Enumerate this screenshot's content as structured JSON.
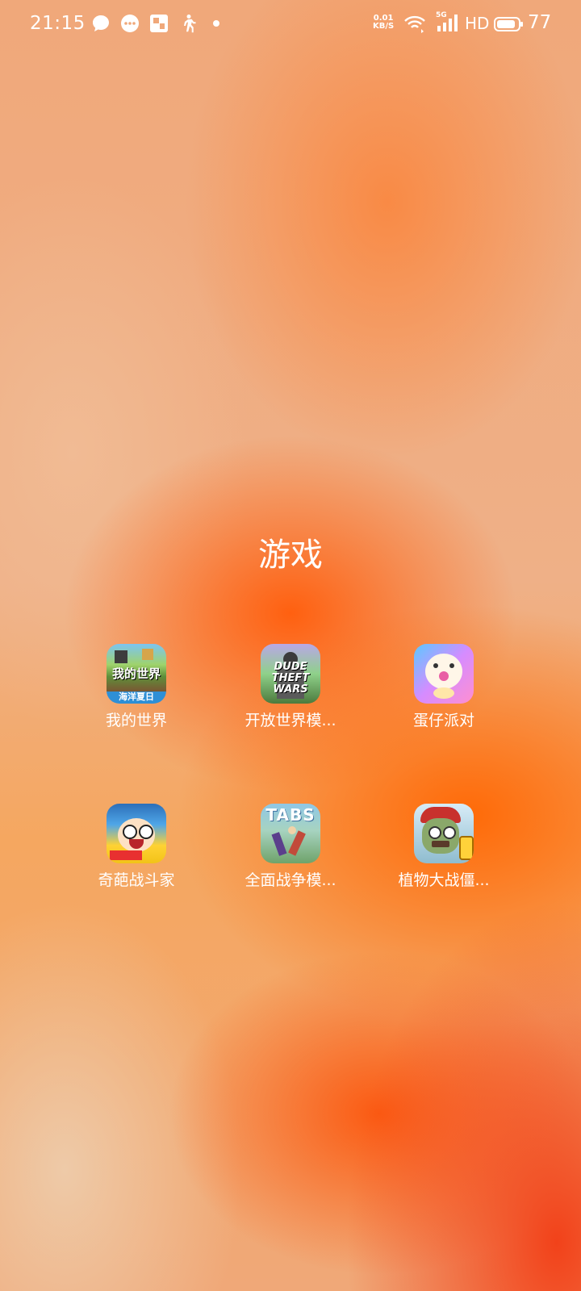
{
  "status_bar": {
    "time": "21:15",
    "net_speed_value": "0.01",
    "net_speed_unit": "KB/S",
    "signal_label": "5G",
    "hd_label": "HD",
    "battery_level": "77",
    "icons": [
      "message-bubble-icon",
      "chat-icon",
      "app-notification-icon",
      "walking-icon",
      "dot-icon",
      "wifi-icon",
      "signal-icon",
      "battery-icon"
    ]
  },
  "folder": {
    "title": "游戏",
    "apps": [
      {
        "label": "我的世界",
        "icon": "minecraft-app-icon",
        "icon_text": "我的世界",
        "icon_subtext": "海洋夏日"
      },
      {
        "label": "开放世界模...",
        "icon": "dude-theft-wars-app-icon",
        "icon_text": "DUDE THEFT WARS"
      },
      {
        "label": "蛋仔派对",
        "icon": "eggy-party-app-icon"
      },
      {
        "label": "奇葩战斗家",
        "icon": "odd-fighter-app-icon"
      },
      {
        "label": "全面战争模...",
        "icon": "tabs-app-icon",
        "icon_text": "TABS"
      },
      {
        "label": "植物大战僵...",
        "icon": "plants-vs-zombies-app-icon"
      }
    ]
  }
}
